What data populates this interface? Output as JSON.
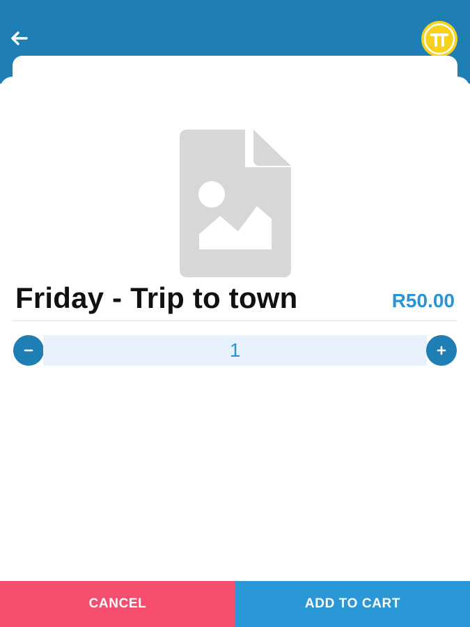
{
  "header": {
    "back_icon": "arrow-left-icon",
    "logo_icon": "pi-logo-icon",
    "colors": {
      "bar": "#1f7fb5",
      "logo": "#f6d21c"
    }
  },
  "product": {
    "image_icon": "image-placeholder-icon",
    "title": "Friday - Trip to town",
    "price": "R50.00"
  },
  "quantity": {
    "value": "1",
    "decrement_icon": "minus-icon",
    "increment_icon": "plus-icon"
  },
  "actions": {
    "cancel_label": "CANCEL",
    "add_label": "ADD TO CART",
    "colors": {
      "cancel": "#f44d6e",
      "add": "#2a97d6"
    }
  }
}
